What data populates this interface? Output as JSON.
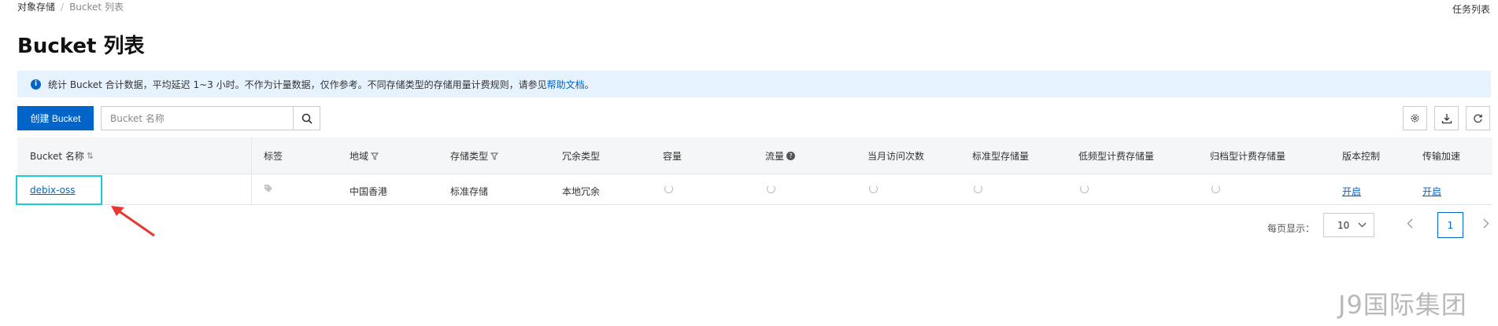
{
  "breadcrumb": {
    "root": "对象存储",
    "separator": "/",
    "current": "Bucket 列表"
  },
  "header": {
    "task_list": "任务列表",
    "title": "Bucket 列表"
  },
  "notice": {
    "icon": "info-icon",
    "text": "统计 Bucket 合计数据，平均延迟 1~3 小时。不作为计量数据，仅作参考。不同存储类型的存储用量计费规则，请参见",
    "link": "帮助文档",
    "suffix": "。"
  },
  "toolbar": {
    "create_label": "创建 Bucket",
    "search_placeholder": "Bucket 名称",
    "icons": [
      "search-icon",
      "gear-icon",
      "download-icon",
      "refresh-icon"
    ]
  },
  "table": {
    "headers": {
      "name": "Bucket 名称",
      "tag": "标签",
      "region": "地域",
      "storage_class": "存储类型",
      "redundancy": "冗余类型",
      "capacity": "容量",
      "traffic": "流量",
      "monthly_requests": "当月访问次数",
      "std_storage": "标准型存储量",
      "ia_storage": "低频型计费存储量",
      "archive_storage": "归档型计费存储量",
      "versioning": "版本控制",
      "acceleration": "传输加速"
    },
    "rows": [
      {
        "name": "debix-oss",
        "region": "中国香港",
        "storage_class": "标准存储",
        "redundancy": "本地冗余",
        "versioning": "开启",
        "acceleration": "开启"
      }
    ]
  },
  "pagination": {
    "page_size_label": "每页显示：",
    "page_size": "10",
    "current_page": "1"
  },
  "watermark": "J9国际集团",
  "colors": {
    "primary": "#0064c8",
    "notice_bg": "#e6f2fd",
    "highlight": "#19cdd7",
    "arrow": "#e8382f"
  }
}
